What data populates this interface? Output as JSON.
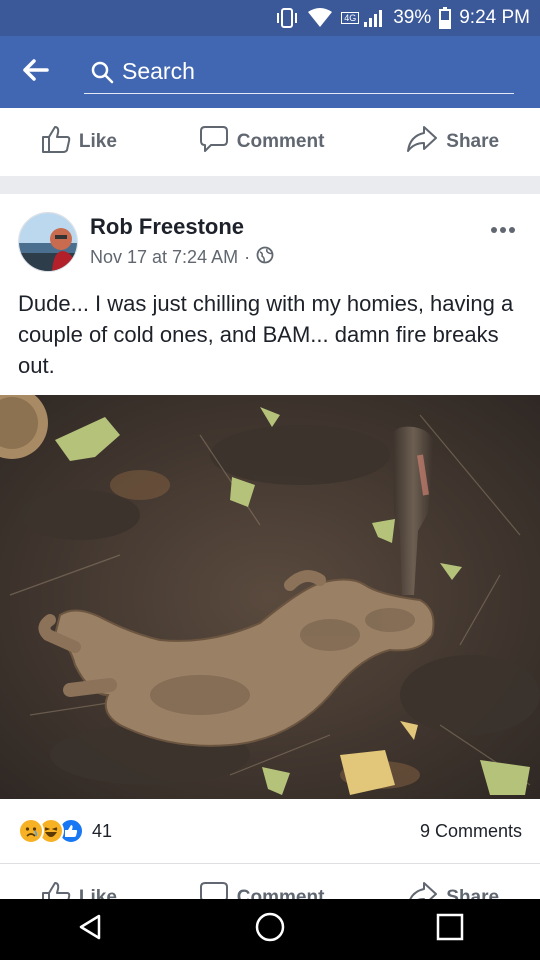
{
  "status_bar": {
    "battery": "39%",
    "time": "9:24 PM",
    "network_badge": "4G"
  },
  "search": {
    "placeholder": "Search"
  },
  "actions": {
    "like": "Like",
    "comment": "Comment",
    "share": "Share"
  },
  "post": {
    "author": "Rob Freestone",
    "timestamp": "Nov 17 at 7:24 AM",
    "separator": "·",
    "text": "Dude... I was just chilling with my homies, having a couple of cold ones, and BAM... damn fire breaks out.",
    "reaction_count": "41",
    "comments_count": "9 Comments"
  },
  "colors": {
    "brand_dark": "#3b5998",
    "brand": "#4267b2",
    "like_blue": "#1877f2",
    "reaction_yellow": "#f7b125"
  },
  "icons": [
    "vibrate-icon",
    "wifi-icon",
    "signal-icon",
    "battery-icon",
    "back-arrow-icon",
    "search-icon",
    "like-icon",
    "comment-icon",
    "share-icon",
    "globe-icon",
    "more-icon",
    "sad-reaction-icon",
    "haha-reaction-icon",
    "like-reaction-icon",
    "nav-back-icon",
    "nav-home-icon",
    "nav-recents-icon"
  ]
}
